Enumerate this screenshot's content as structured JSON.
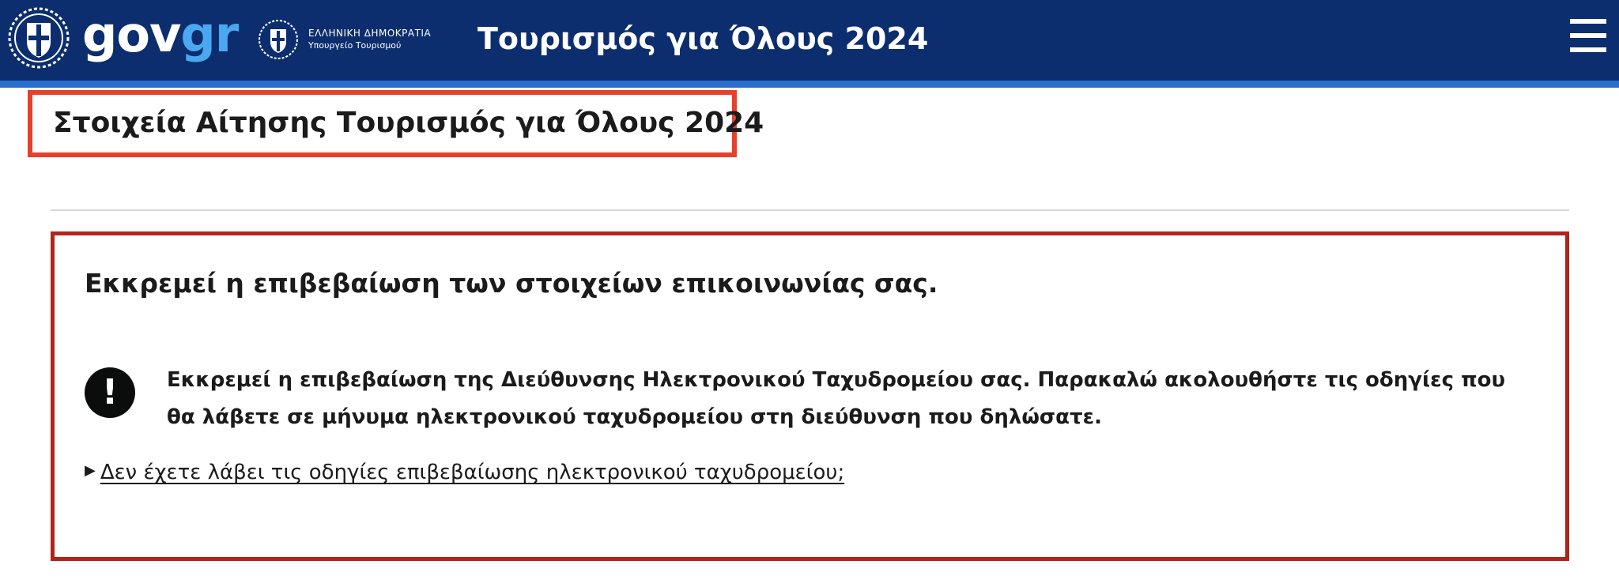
{
  "header": {
    "brand_gov": "gov",
    "brand_gr": "gr",
    "ministry_line1": "ΕΛΛΗΝΙΚΗ ΔΗΜΟΚΡΑΤΙΑ",
    "ministry_line2": "Υπουργείο Τουρισμού",
    "title": "Τουρισμός για Όλους 2024",
    "colors": {
      "background": "#0d2e6e",
      "stripe": "#2a6fcf",
      "brand_accent": "#4aa8f0"
    }
  },
  "page": {
    "title": "Στοιχεία Αίτησης Τουρισμός για Όλους 2024"
  },
  "notice": {
    "heading": "Εκκρεμεί η επιβεβαίωση των στοιχείων επικοινωνίας σας.",
    "icon": "exclamation-icon",
    "icon_glyph": "!",
    "message_line1": "Εκκρεμεί η επιβεβαίωση της Διεύθυνσης Ηλεκτρονικού Ταχυδρομείου σας. Παρακαλώ ακολουθήστε τις οδηγίες που",
    "message_line2": "θα λάβετε σε μήνυμα ηλεκτρονικού ταχυδρομείου στη διεύθυνση που δηλώσατε.",
    "details_arrow": "▶",
    "details_label": "Δεν έχετε λάβει τις οδηγίες επιβεβαίωσης ηλεκτρονικού ταχυδρομείου;",
    "colors": {
      "border": "#b1241a",
      "highlight": "#e8402a"
    }
  }
}
